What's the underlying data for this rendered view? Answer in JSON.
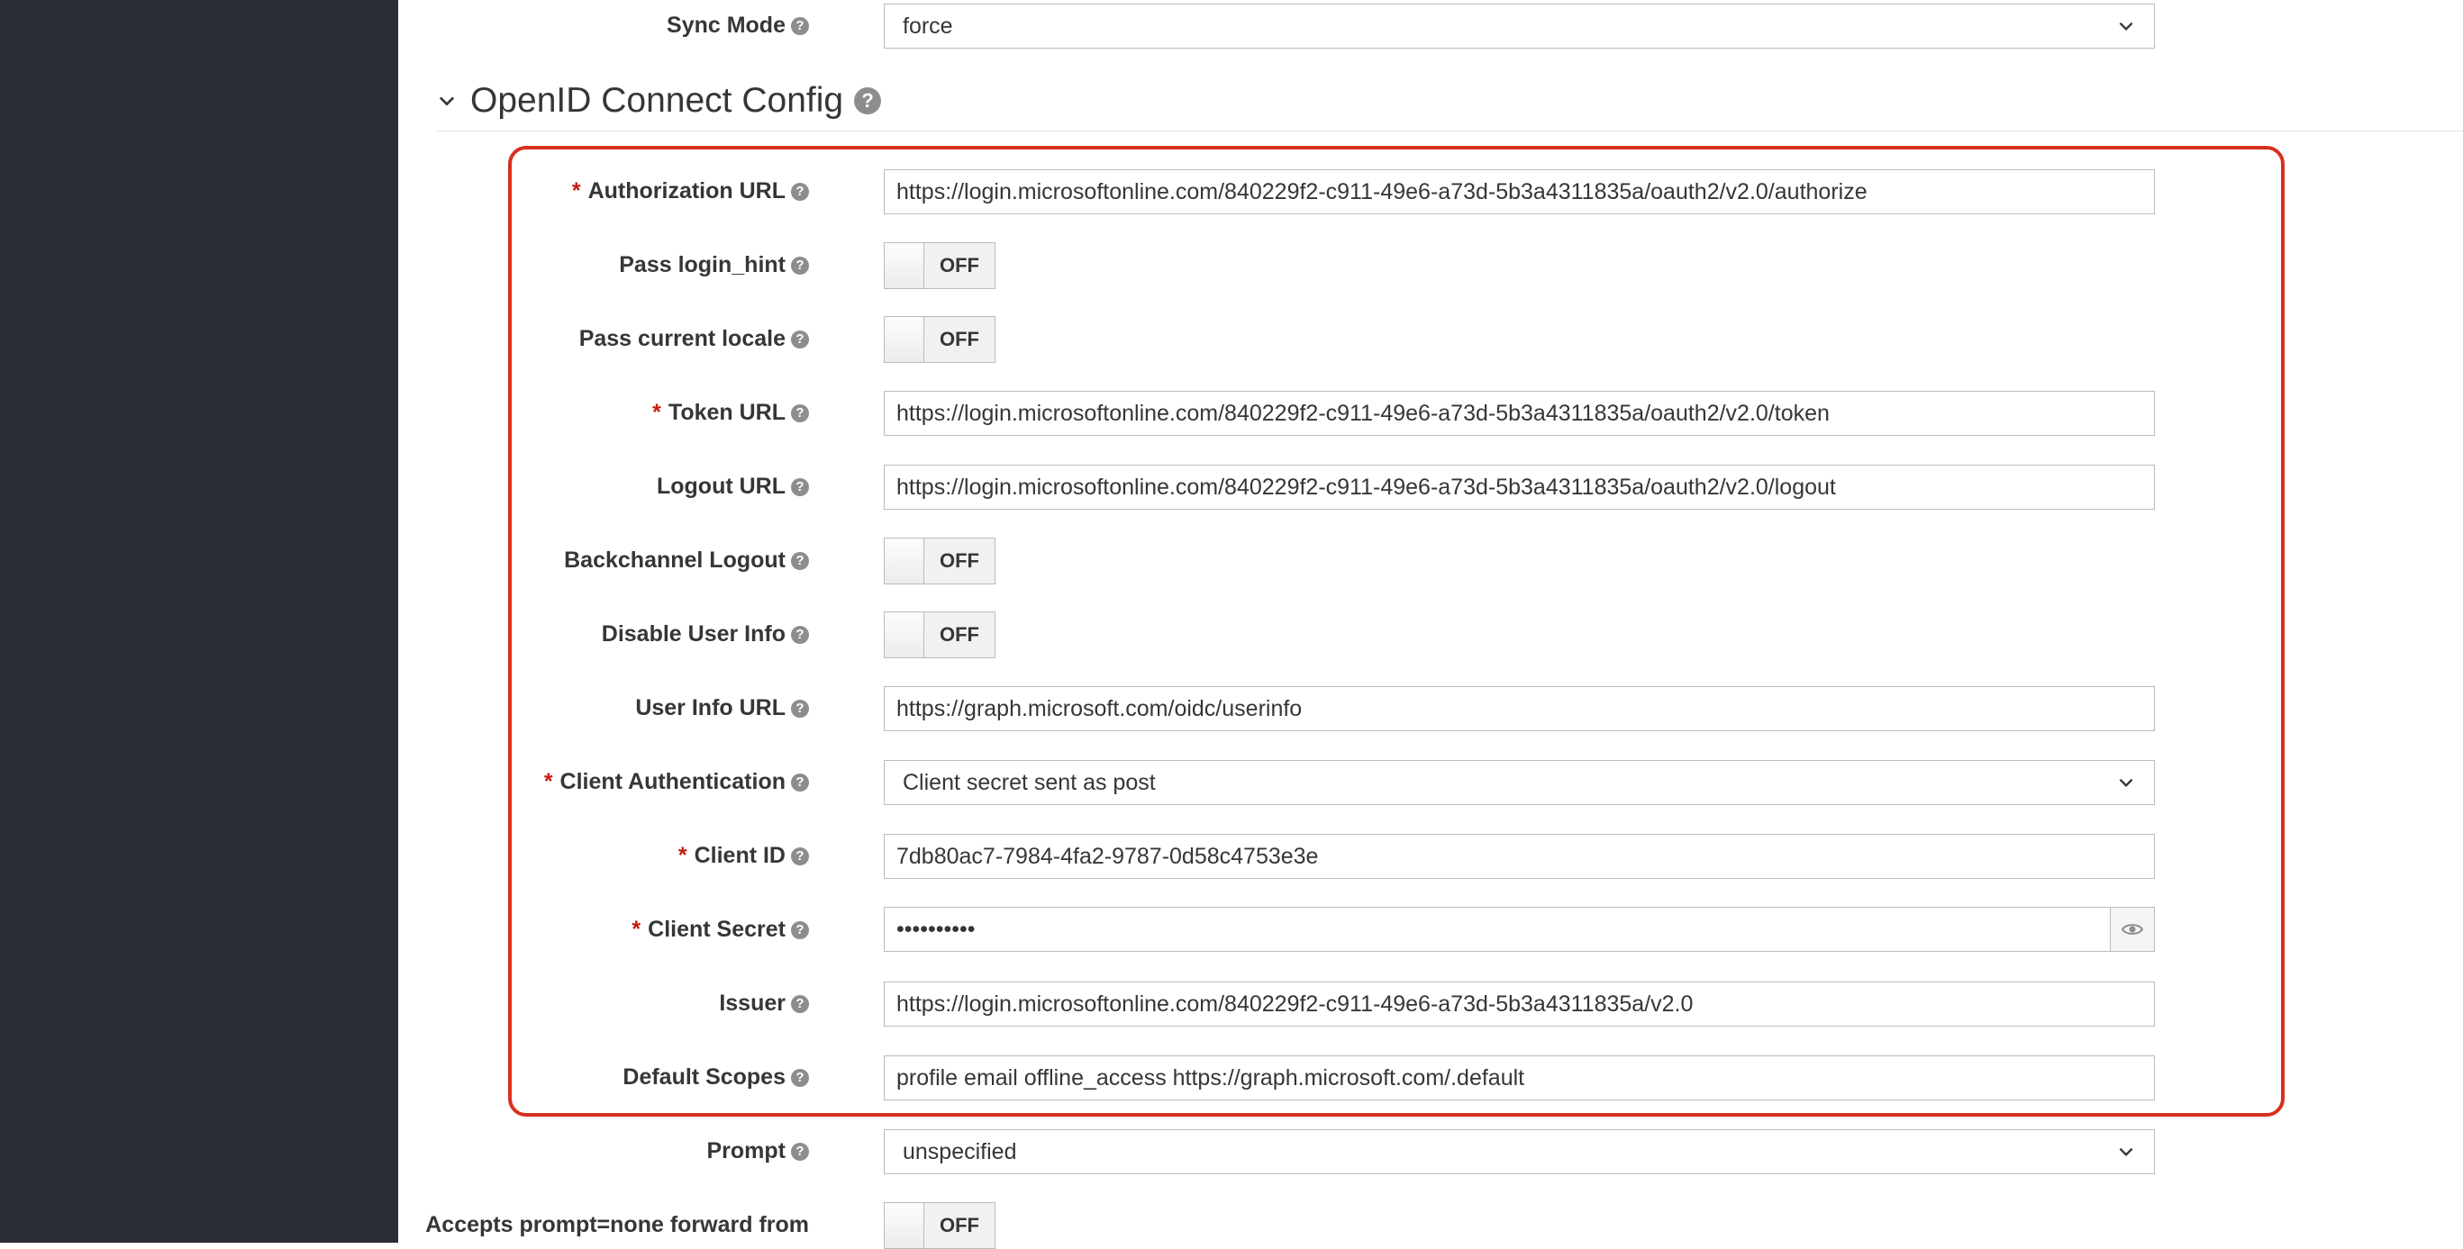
{
  "sync_mode": {
    "label": "Sync Mode",
    "value": "force"
  },
  "section": {
    "title": "OpenID Connect Config"
  },
  "fields": {
    "authorization_url": {
      "label": "Authorization URL",
      "value": "https://login.microsoftonline.com/840229f2-c911-49e6-a73d-5b3a4311835a/oauth2/v2.0/authorize"
    },
    "pass_login_hint": {
      "label": "Pass login_hint",
      "state": "OFF"
    },
    "pass_current_locale": {
      "label": "Pass current locale",
      "state": "OFF"
    },
    "token_url": {
      "label": "Token URL",
      "value": "https://login.microsoftonline.com/840229f2-c911-49e6-a73d-5b3a4311835a/oauth2/v2.0/token"
    },
    "logout_url": {
      "label": "Logout URL",
      "value": "https://login.microsoftonline.com/840229f2-c911-49e6-a73d-5b3a4311835a/oauth2/v2.0/logout"
    },
    "backchannel_logout": {
      "label": "Backchannel Logout",
      "state": "OFF"
    },
    "disable_user_info": {
      "label": "Disable User Info",
      "state": "OFF"
    },
    "user_info_url": {
      "label": "User Info URL",
      "value": "https://graph.microsoft.com/oidc/userinfo"
    },
    "client_authentication": {
      "label": "Client Authentication",
      "value": "Client secret sent as post"
    },
    "client_id": {
      "label": "Client ID",
      "value": "7db80ac7-7984-4fa2-9787-0d58c4753e3e"
    },
    "client_secret": {
      "label": "Client Secret",
      "value": "••••••••••"
    },
    "issuer": {
      "label": "Issuer",
      "value": "https://login.microsoftonline.com/840229f2-c911-49e6-a73d-5b3a4311835a/v2.0"
    },
    "default_scopes": {
      "label": "Default Scopes",
      "value": "profile email offline_access https://graph.microsoft.com/.default"
    },
    "prompt": {
      "label": "Prompt",
      "value": "unspecified"
    },
    "accepts_prompt_none": {
      "label": "Accepts prompt=none forward from",
      "state": "OFF"
    }
  },
  "required_marker": "*",
  "help_glyph": "?",
  "icons": {
    "help": "question-circle-icon",
    "dropdown": "chevron-down-icon",
    "section": "chevron-down-icon",
    "reveal": "eye-icon"
  },
  "colors": {
    "sidebar": "#292e34",
    "required": "#c9190b",
    "highlight": "#d7301f",
    "help_icon": "#8b8d8f"
  }
}
